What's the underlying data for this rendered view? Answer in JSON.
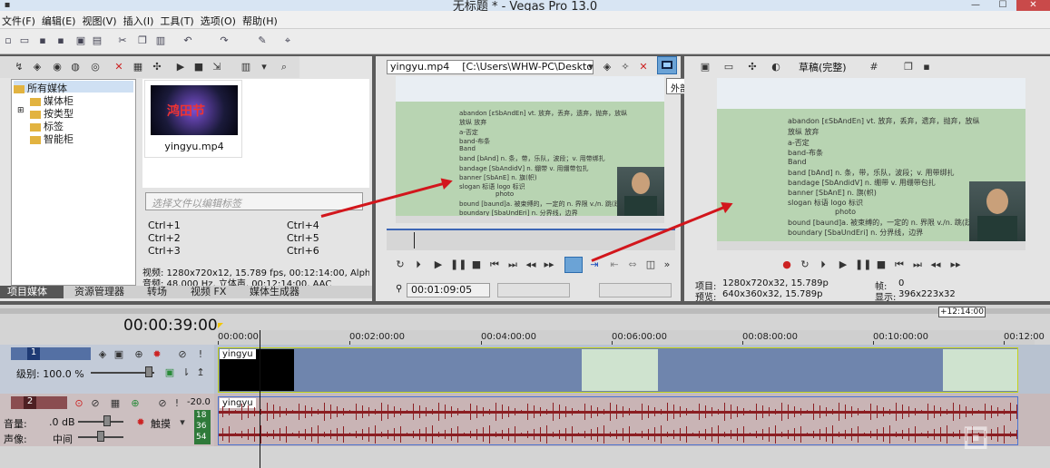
{
  "window": {
    "title": "无标题 * - Vegas Pro 13.0",
    "minimize": "—",
    "maximize": "☐",
    "close": "✕"
  },
  "menu": [
    "文件(F)",
    "编辑(E)",
    "视图(V)",
    "插入(I)",
    "工具(T)",
    "选项(O)",
    "帮助(H)"
  ],
  "explorer": {
    "tree": [
      "所有媒体",
      "媒体柜",
      "按类型",
      "标签",
      "智能柜"
    ],
    "thumb_caption": "yingyu.mp4",
    "thumb_overlay": "鸿田节",
    "tag_placeholder": "选择文件以编辑标签",
    "shortcuts": [
      "Ctrl+1",
      "Ctrl+2",
      "Ctrl+3",
      "Ctrl+4",
      "Ctrl+5",
      "Ctrl+6"
    ],
    "info_line1": "视频: 1280x720x12, 15.789 fps, 00:12:14:00, Alpha",
    "info_line2": "音频: 48,000 Hz, 立体声, 00:12:14:00, AAC",
    "tabs": [
      "项目媒体",
      "资源管理器",
      "转场",
      "视频 FX",
      "媒体生成器"
    ]
  },
  "trimmer": {
    "file": "yingyu.mp4",
    "path": "[C:\\Users\\WHW-PC\\Desktop\\]",
    "time": "00:01:09:05"
  },
  "tooltip": "外部监视器上的修剪器",
  "doc": {
    "words": [
      "abandon [ɛSbAndEn]  vt. 放弃，丢弃，遗弃，抛弃，放纵",
      "放纵 放弃",
      "a-否定",
      "band-布条",
      "Band",
      "band [bAnd]   n. 条，带，乐队，波段；v. 用带绑扎",
      "bandage [SbAndidV]  n. 绷带  v. 用绷带包扎",
      "banner  [SbAnE]   n. 旗(帜)",
      "slogan  标语  logo  标识",
      "photo",
      "bound  [baund]a. 被束缚的，一定的  n. 界限 v./n. 跳(跃)",
      "boundary [SbaUndEri]  n. 分界线，边界"
    ]
  },
  "preview": {
    "quality": "草稿(完整)",
    "project_label": "项目:",
    "project_value": "1280x720x32, 15.789p",
    "preview_label": "预览:",
    "preview_value": "640x360x32, 15.789p",
    "frame_label": "帧:",
    "frame_value": "0",
    "display_label": "显示:",
    "display_value": "396x223x32"
  },
  "timeline": {
    "current_time": "00:00:39:00",
    "region": "+12:14:00",
    "ticks": [
      "00:00:00",
      "00:02:00:00",
      "00:04:00:00",
      "00:06:00:00",
      "00:08:00:00",
      "00:10:00:00",
      "00:12:00"
    ],
    "track1": {
      "num": "1",
      "level": "级别: 100.0 %",
      "clip": "yingyu"
    },
    "track2": {
      "num": "2",
      "volume_label": "音量:",
      "volume": ".0 dB",
      "pan_label": "声像:",
      "pan": "中间",
      "touch": "触摸",
      "meter": "-20.0",
      "meter_ticks": [
        "18",
        "36",
        "54"
      ],
      "clip": "yingyu"
    }
  },
  "colors": {
    "arrow": "#d2161c",
    "meter": "#2f7a3a"
  }
}
